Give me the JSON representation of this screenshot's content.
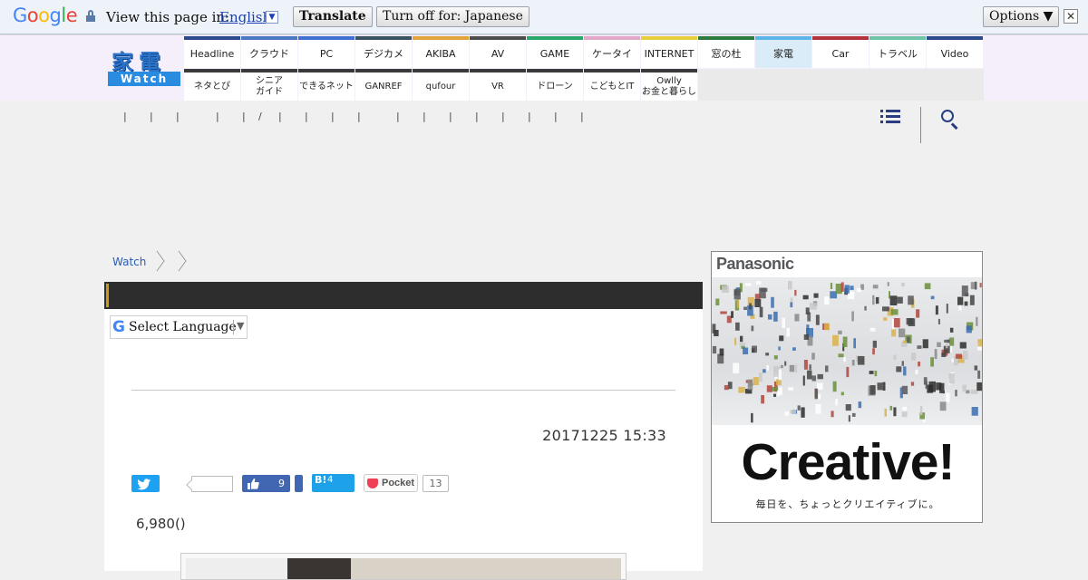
{
  "translate_bar": {
    "logo": "Google",
    "prompt": "View this page in:",
    "language": "English",
    "translate_label": "Translate",
    "turn_off_label": "Turn off for: Japanese",
    "options_label": "Options ▼",
    "close_glyph": "✕"
  },
  "site": {
    "logo_kanji": "家電",
    "logo_watch": "Watch",
    "nav_row1": [
      {
        "label": "Headline",
        "color": "#2b4a8e"
      },
      {
        "label": "クラウド",
        "color": "#4a79c4"
      },
      {
        "label": "PC",
        "color": "#3f6fd0"
      },
      {
        "label": "デジカメ",
        "color": "#3a5360"
      },
      {
        "label": "AKIBA",
        "color": "#e0a43a"
      },
      {
        "label": "AV",
        "color": "#4c4c4c"
      },
      {
        "label": "GAME",
        "color": "#2aa86a"
      },
      {
        "label": "ケータイ",
        "color": "#e2a6c9"
      },
      {
        "label": "INTERNET",
        "color": "#e7cf3b"
      },
      {
        "label": "窓の杜",
        "color": "#2c7b3e"
      },
      {
        "label": "家電",
        "color": "#5bb5e8",
        "active": true
      },
      {
        "label": "Car",
        "color": "#b3313a"
      },
      {
        "label": "トラベル",
        "color": "#6ec3a8"
      },
      {
        "label": "Video",
        "color": "#2a4a8c"
      }
    ],
    "nav_row2": [
      {
        "label": "ネタとぴ"
      },
      {
        "label": "シニア\nガイド"
      },
      {
        "label": "できるネット"
      },
      {
        "label": "GANREF"
      },
      {
        "label": "qufour"
      },
      {
        "label": "VR"
      },
      {
        "label": "ドローン"
      },
      {
        "label": "こどもとIT"
      },
      {
        "label": "Owlly\nお金と暮らし"
      }
    ]
  },
  "subnav": {
    "separators": [
      "|",
      "|",
      "|",
      "|",
      "|",
      "/",
      "|",
      "|",
      "|",
      "|",
      "|",
      "|",
      "|",
      "|",
      "|",
      "|",
      "|",
      "|",
      "|"
    ]
  },
  "breadcrumb": {
    "home": "Watch"
  },
  "article": {
    "translate_widget_label": "Select Language",
    "translate_widget_arrow": "▼",
    "translate_widget_g": "G",
    "date": "20171225 15:33",
    "price": "6,980()",
    "share": {
      "facebook_count": "9",
      "hatena_label": "B!",
      "hatena_count": "4",
      "pocket_label": "Pocket",
      "pocket_count": "13"
    }
  },
  "ad": {
    "brand": "Panasonic",
    "headline": "Creative!",
    "tagline": "毎日を、ちょっとクリエイティブに。"
  }
}
